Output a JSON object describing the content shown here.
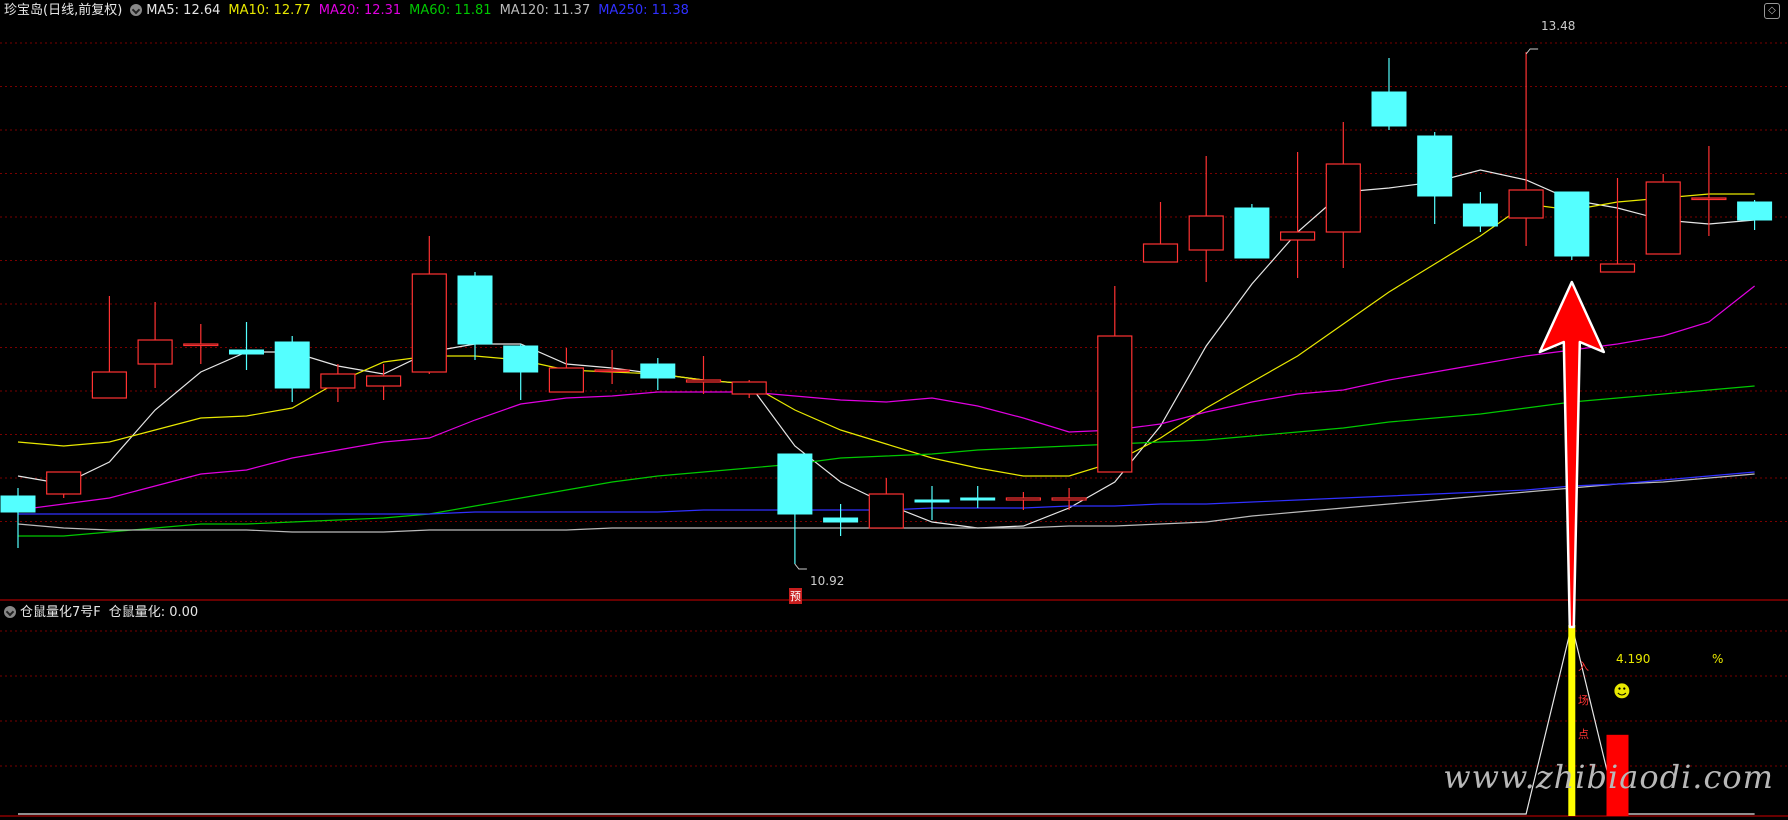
{
  "header": {
    "stock_label": "珍宝岛(日线,前复权)",
    "ma_values": [
      {
        "label": "MA5: 12.64",
        "color": "#e6e6e6"
      },
      {
        "label": "MA10: 12.77",
        "color": "#e8e800"
      },
      {
        "label": "MA20: 12.31",
        "color": "#e000e0"
      },
      {
        "label": "MA60: 11.81",
        "color": "#00c800"
      },
      {
        "label": "MA120: 11.37",
        "color": "#bbbbbb"
      },
      {
        "label": "MA250: 11.38",
        "color": "#3030ff"
      }
    ]
  },
  "sub_header": {
    "indicator_name": "仓鼠量化7号F",
    "indicator_value": "仓鼠量化: 0.00"
  },
  "annotations": {
    "high_label": "13.48",
    "low_label": "10.92",
    "low_tag": "预",
    "pct_value": "4.190",
    "pct_sign": "%",
    "smiley": "☻",
    "vertical_chars": [
      "入",
      "场",
      "点"
    ]
  },
  "watermark": "www.zhibiaodi.com",
  "colors": {
    "up": "#ff3232",
    "down": "#54ffff",
    "grid": "#7a0000",
    "arrow": "#ff0000",
    "signal": "#ffff00"
  },
  "chart_data": [
    {
      "type": "candlestick",
      "title": "",
      "ylim": [
        10.8,
        13.6
      ],
      "categories": [
        1,
        2,
        3,
        4,
        5,
        6,
        7,
        8,
        9,
        10,
        11,
        12,
        13,
        14,
        15,
        16,
        17,
        18,
        19,
        20,
        21,
        22,
        23,
        24,
        25,
        26,
        27,
        28,
        29,
        30,
        31,
        32,
        33,
        34,
        35,
        36,
        37,
        38,
        39
      ],
      "series": [
        {
          "name": "candles",
          "values": [
            {
              "o": 11.26,
              "h": 11.3,
              "l": 11.0,
              "c": 11.18
            },
            {
              "o": 11.27,
              "h": 11.38,
              "l": 11.25,
              "c": 11.38
            },
            {
              "o": 11.75,
              "h": 12.26,
              "l": 11.75,
              "c": 11.88
            },
            {
              "o": 11.92,
              "h": 12.23,
              "l": 11.8,
              "c": 12.04
            },
            {
              "o": 12.02,
              "h": 12.12,
              "l": 11.92,
              "c": 12.02
            },
            {
              "o": 11.99,
              "h": 12.13,
              "l": 11.89,
              "c": 11.97
            },
            {
              "o": 12.03,
              "h": 12.06,
              "l": 11.73,
              "c": 11.8
            },
            {
              "o": 11.8,
              "h": 11.92,
              "l": 11.73,
              "c": 11.87
            },
            {
              "o": 11.81,
              "h": 11.92,
              "l": 11.74,
              "c": 11.86
            },
            {
              "o": 11.88,
              "h": 12.56,
              "l": 11.87,
              "c": 12.37
            },
            {
              "o": 12.36,
              "h": 12.38,
              "l": 11.94,
              "c": 12.02
            },
            {
              "o": 12.01,
              "h": 12.02,
              "l": 11.74,
              "c": 11.88
            },
            {
              "o": 11.78,
              "h": 12.0,
              "l": 11.78,
              "c": 11.9
            },
            {
              "o": 11.89,
              "h": 11.99,
              "l": 11.82,
              "c": 11.89
            },
            {
              "o": 11.92,
              "h": 11.95,
              "l": 11.79,
              "c": 11.85
            },
            {
              "o": 11.83,
              "h": 11.96,
              "l": 11.77,
              "c": 11.84
            },
            {
              "o": 11.77,
              "h": 11.84,
              "l": 11.75,
              "c": 11.83
            },
            {
              "o": 11.47,
              "h": 11.47,
              "l": 10.92,
              "c": 11.17
            },
            {
              "o": 11.15,
              "h": 11.22,
              "l": 11.06,
              "c": 11.13
            },
            {
              "o": 11.1,
              "h": 11.35,
              "l": 11.1,
              "c": 11.27
            },
            {
              "o": 11.24,
              "h": 11.31,
              "l": 11.14,
              "c": 11.23
            },
            {
              "o": 11.25,
              "h": 11.31,
              "l": 11.2,
              "c": 11.24
            },
            {
              "o": 11.24,
              "h": 11.28,
              "l": 11.19,
              "c": 11.25
            },
            {
              "o": 11.24,
              "h": 11.3,
              "l": 11.19,
              "c": 11.25
            },
            {
              "o": 11.38,
              "h": 12.31,
              "l": 11.38,
              "c": 12.06
            },
            {
              "o": 12.43,
              "h": 12.73,
              "l": 12.45,
              "c": 12.52
            },
            {
              "o": 12.49,
              "h": 12.96,
              "l": 12.33,
              "c": 12.66
            },
            {
              "o": 12.7,
              "h": 12.72,
              "l": 12.48,
              "c": 12.45
            },
            {
              "o": 12.54,
              "h": 12.98,
              "l": 12.35,
              "c": 12.58
            },
            {
              "o": 12.58,
              "h": 13.13,
              "l": 12.4,
              "c": 12.92
            },
            {
              "o": 13.28,
              "h": 13.45,
              "l": 13.09,
              "c": 13.11
            },
            {
              "o": 13.06,
              "h": 13.08,
              "l": 12.62,
              "c": 12.76
            },
            {
              "o": 12.72,
              "h": 12.78,
              "l": 12.58,
              "c": 12.61
            },
            {
              "o": 12.65,
              "h": 13.48,
              "l": 12.51,
              "c": 12.79
            },
            {
              "o": 12.78,
              "h": 12.76,
              "l": 12.44,
              "c": 12.46
            },
            {
              "o": 12.38,
              "h": 12.85,
              "l": 12.4,
              "c": 12.42
            },
            {
              "o": 12.47,
              "h": 12.87,
              "l": 12.47,
              "c": 12.83
            },
            {
              "o": 12.75,
              "h": 13.01,
              "l": 12.56,
              "c": 12.75
            },
            {
              "o": 12.73,
              "h": 12.74,
              "l": 12.59,
              "c": 12.64
            }
          ]
        },
        {
          "name": "MA5",
          "values": [
            11.36,
            11.32,
            11.43,
            11.69,
            11.88,
            11.98,
            11.98,
            11.91,
            11.87,
            11.98,
            12.02,
            12.02,
            11.92,
            11.9,
            11.87,
            11.84,
            11.82,
            11.51,
            11.33,
            11.22,
            11.13,
            11.1,
            11.11,
            11.2,
            11.33,
            11.61,
            12.01,
            12.32,
            12.58,
            12.78,
            12.8,
            12.83,
            12.89,
            12.84,
            12.74,
            12.7,
            12.64,
            12.62,
            12.64
          ]
        },
        {
          "name": "MA10",
          "values": [
            11.53,
            11.51,
            11.53,
            11.59,
            11.65,
            11.66,
            11.7,
            11.83,
            11.93,
            11.96,
            11.96,
            11.94,
            11.89,
            11.88,
            11.87,
            11.84,
            11.82,
            11.69,
            11.59,
            11.52,
            11.45,
            11.4,
            11.36,
            11.36,
            11.43,
            11.55,
            11.7,
            11.83,
            11.96,
            12.12,
            12.28,
            12.42,
            12.56,
            12.72,
            12.69,
            12.73,
            12.75,
            12.77,
            12.77
          ]
        },
        {
          "name": "MA20",
          "values": [
            11.19,
            11.22,
            11.25,
            11.31,
            11.37,
            11.39,
            11.45,
            11.49,
            11.53,
            11.55,
            11.64,
            11.72,
            11.75,
            11.76,
            11.78,
            11.78,
            11.78,
            11.76,
            11.74,
            11.73,
            11.75,
            11.71,
            11.65,
            11.58,
            11.59,
            11.62,
            11.68,
            11.73,
            11.77,
            11.79,
            11.84,
            11.88,
            11.92,
            11.96,
            11.99,
            12.02,
            12.06,
            12.13,
            12.31
          ]
        },
        {
          "name": "MA60",
          "values": [
            11.06,
            11.06,
            11.08,
            11.1,
            11.12,
            11.12,
            11.13,
            11.14,
            11.15,
            11.17,
            11.21,
            11.25,
            11.29,
            11.33,
            11.36,
            11.38,
            11.4,
            11.42,
            11.45,
            11.46,
            11.47,
            11.49,
            11.5,
            11.51,
            11.52,
            11.53,
            11.54,
            11.56,
            11.58,
            11.6,
            11.63,
            11.65,
            11.67,
            11.7,
            11.73,
            11.75,
            11.77,
            11.79,
            11.81
          ]
        },
        {
          "name": "MA120",
          "values": [
            11.12,
            11.1,
            11.09,
            11.09,
            11.09,
            11.09,
            11.08,
            11.08,
            11.08,
            11.09,
            11.09,
            11.09,
            11.09,
            11.1,
            11.1,
            11.1,
            11.1,
            11.1,
            11.1,
            11.1,
            11.1,
            11.1,
            11.1,
            11.11,
            11.11,
            11.12,
            11.13,
            11.16,
            11.18,
            11.2,
            11.22,
            11.24,
            11.26,
            11.28,
            11.3,
            11.32,
            11.33,
            11.35,
            11.37
          ]
        },
        {
          "name": "MA250",
          "values": [
            11.17,
            11.17,
            11.17,
            11.17,
            11.17,
            11.17,
            11.17,
            11.17,
            11.17,
            11.17,
            11.18,
            11.18,
            11.18,
            11.18,
            11.18,
            11.19,
            11.19,
            11.19,
            11.19,
            11.19,
            11.2,
            11.2,
            11.2,
            11.21,
            11.21,
            11.22,
            11.22,
            11.23,
            11.24,
            11.25,
            11.26,
            11.27,
            11.28,
            11.29,
            11.31,
            11.32,
            11.34,
            11.36,
            11.38
          ]
        }
      ]
    },
    {
      "type": "line",
      "title": "",
      "ylim": [
        0,
        10
      ],
      "categories": [
        1,
        2,
        3,
        4,
        5,
        6,
        7,
        8,
        9,
        10,
        11,
        12,
        13,
        14,
        15,
        16,
        17,
        18,
        19,
        20,
        21,
        22,
        23,
        24,
        25,
        26,
        27,
        28,
        29,
        30,
        31,
        32,
        33,
        34,
        35,
        36,
        37,
        38,
        39
      ],
      "series": [
        {
          "name": "仓鼠量化",
          "values": [
            0,
            0,
            0,
            0,
            0,
            0,
            0,
            0,
            0,
            0,
            0,
            0,
            0,
            0,
            0,
            0,
            0,
            0,
            0,
            0,
            0,
            0,
            0,
            0,
            0,
            0,
            0,
            0,
            0,
            0,
            0,
            0,
            0,
            0,
            10,
            0,
            0,
            0,
            0
          ]
        },
        {
          "name": "signal_bar_red",
          "values": [
            0,
            0,
            0,
            0,
            0,
            0,
            0,
            0,
            0,
            0,
            0,
            0,
            0,
            0,
            0,
            0,
            0,
            0,
            0,
            0,
            0,
            0,
            0,
            0,
            0,
            0,
            0,
            0,
            0,
            0,
            0,
            0,
            0,
            0,
            0,
            4.19,
            0,
            0,
            0
          ]
        }
      ]
    }
  ]
}
